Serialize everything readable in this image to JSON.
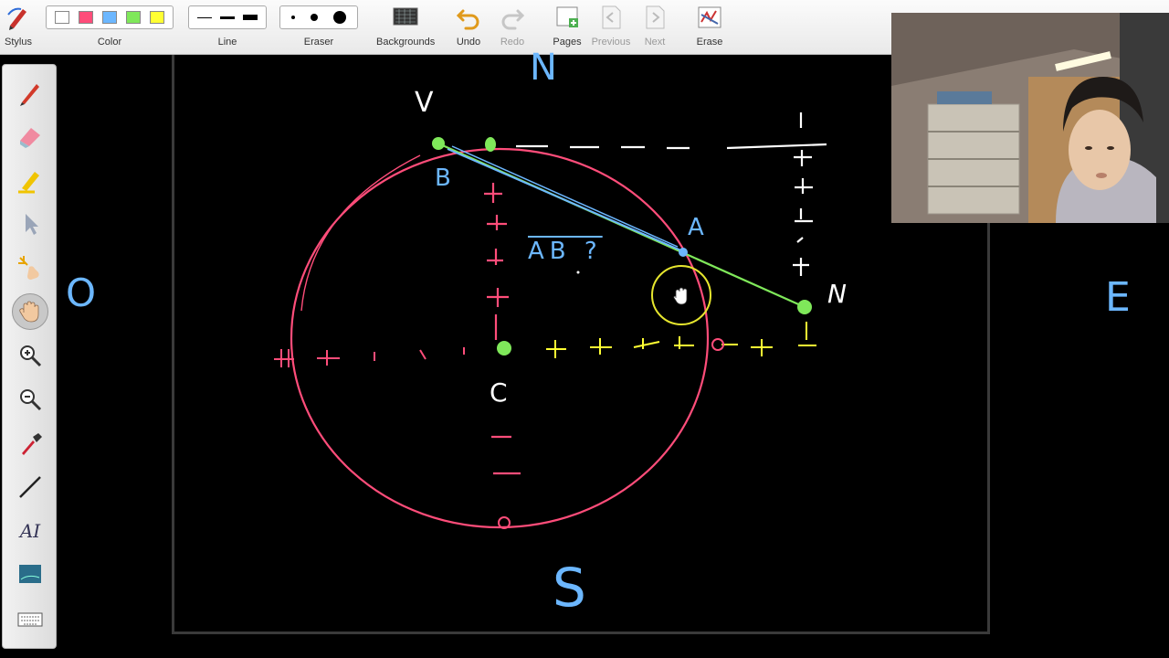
{
  "toolbar": {
    "stylus": "Stylus",
    "color": "Color",
    "line": "Line",
    "eraser": "Eraser",
    "backgrounds": "Backgrounds",
    "undo": "Undo",
    "redo": "Redo",
    "pages": "Pages",
    "previous": "Previous",
    "next": "Next",
    "erase": "Erase",
    "colors": [
      "#ffffff",
      "#ff4d7a",
      "#6cb7ff",
      "#7fe85a",
      "#ffff33"
    ]
  },
  "palette": {
    "tools": [
      "pen-icon",
      "eraser-icon",
      "highlighter-icon",
      "select-arrow-icon",
      "laser-pointer-icon",
      "hand-pan-icon",
      "zoom-in-icon",
      "zoom-out-icon",
      "eyedropper-icon",
      "line-tool-icon",
      "text-tool-icon",
      "image-tool-icon",
      "keyboard-icon"
    ],
    "text_tool_label": "AI"
  },
  "board": {
    "labels": {
      "north_top": "N",
      "west": "O",
      "east": "E",
      "south": "S",
      "vertex_v": "V",
      "point_b": "B",
      "point_a": "A",
      "point_n": "N",
      "center_c": "C",
      "question": "AB ?"
    },
    "colors": {
      "circle": "#ff4d7a",
      "yellow_axis": "#ffff33",
      "green_line": "#7fe85a",
      "blue_line": "#6cb7ff",
      "white_lines": "#ffffff",
      "pointer_ring": "#e6e62e"
    }
  }
}
